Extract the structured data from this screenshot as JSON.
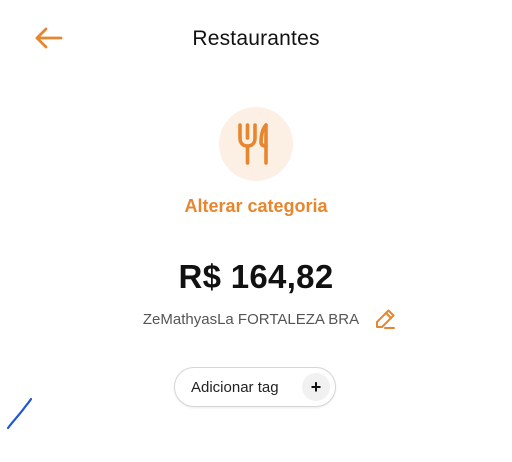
{
  "header": {
    "title": "Restaurantes",
    "back_icon": "arrow-left-icon"
  },
  "category": {
    "icon": "fork-knife-icon",
    "change_label": "Alterar categoria"
  },
  "transaction": {
    "amount": "R$ 164,82",
    "merchant": "ZeMathyasLa FORTALEZA BRA",
    "edit_icon": "pencil-icon"
  },
  "tags": {
    "add_label": "Adicionar tag",
    "add_icon": "+"
  },
  "colors": {
    "accent": "#E8862F",
    "icon_bg": "#FCEFE3",
    "text": "#111111",
    "muted": "#555555",
    "scribble": "#1E56D8"
  }
}
